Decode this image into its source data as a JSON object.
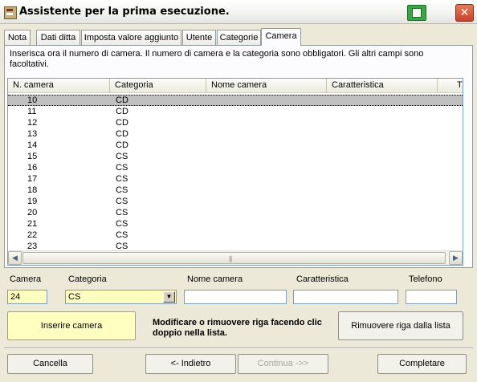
{
  "window": {
    "title": "Assistente per la prima esecuzione.",
    "close_glyph": "✕"
  },
  "tabs": [
    {
      "label": "Nota"
    },
    {
      "label": "Dati ditta"
    },
    {
      "label": "Imposta valore aggiunto"
    },
    {
      "label": "Utente"
    },
    {
      "label": "Categorie"
    },
    {
      "label": "Camera",
      "active": true
    }
  ],
  "info": "Inserisca ora il numero di camera. Il numero di camera e la categoria sono obbligatori. Gli altri campi sono facoltativi.",
  "list": {
    "columns": [
      "N. camera",
      "Categoria",
      "Nome camera",
      "Caratteristica",
      "T"
    ],
    "rows": [
      {
        "n": "10",
        "cat": "CD",
        "selected": true
      },
      {
        "n": "11",
        "cat": "CD"
      },
      {
        "n": "12",
        "cat": "CD"
      },
      {
        "n": "13",
        "cat": "CD"
      },
      {
        "n": "14",
        "cat": "CD"
      },
      {
        "n": "15",
        "cat": "CS"
      },
      {
        "n": "16",
        "cat": "CS"
      },
      {
        "n": "17",
        "cat": "CS"
      },
      {
        "n": "18",
        "cat": "CS"
      },
      {
        "n": "19",
        "cat": "CS"
      },
      {
        "n": "20",
        "cat": "CS"
      },
      {
        "n": "21",
        "cat": "CS"
      },
      {
        "n": "22",
        "cat": "CS"
      },
      {
        "n": "23",
        "cat": "CS"
      }
    ],
    "scroll_left": "◀",
    "scroll_right": "▶",
    "grip": "|||"
  },
  "form": {
    "camera_label": "Camera",
    "camera_value": "24",
    "categoria_label": "Categoria",
    "categoria_value": "CS",
    "nome_label": "Nome camera",
    "nome_value": "",
    "caratteristica_label": "Caratteristica",
    "caratteristica_value": "",
    "telefono_label": "Telefono",
    "telefono_value": "",
    "combo_arrow": "▼"
  },
  "actions": {
    "inserire": "Inserire camera",
    "hint": "Modificare o rimuovere riga facendo clic doppio nella lista.",
    "rimuovere": "Rimuovere riga dalla lista"
  },
  "footer": {
    "cancella": "Cancella",
    "indietro": "<- Indietro",
    "continua": "Continua ->>",
    "completare": "Completare"
  }
}
